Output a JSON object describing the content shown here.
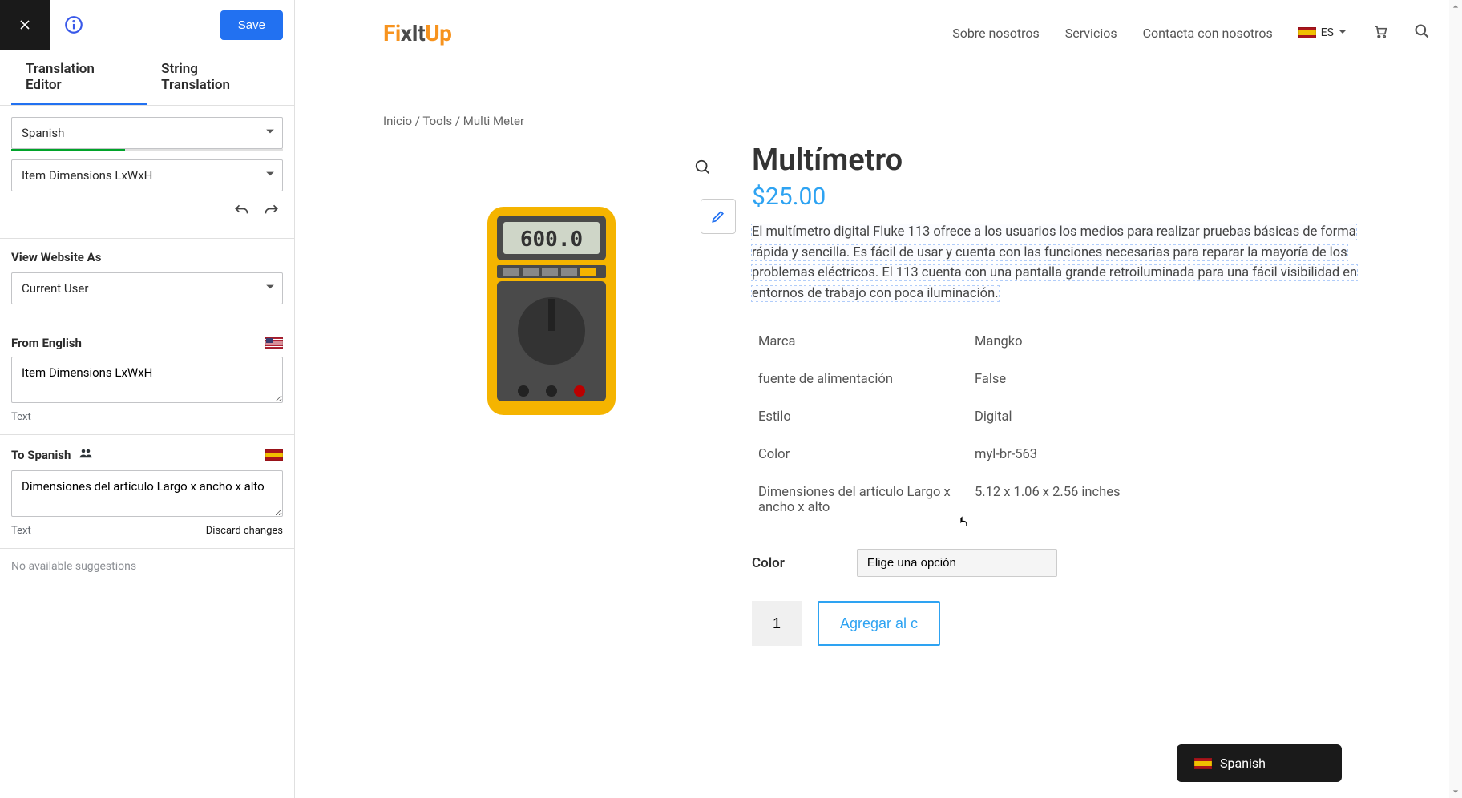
{
  "sidebar": {
    "save_label": "Save",
    "tabs": {
      "editor": "Translation Editor",
      "string": "String Translation"
    },
    "language_select": "Spanish",
    "item_select": "Item Dimensions LxWxH",
    "view_as_title": "View Website As",
    "view_as_value": "Current User",
    "from_label": "From English",
    "from_value": "Item Dimensions LxWxH",
    "from_type": "Text",
    "to_label": "To Spanish",
    "to_value": "Dimensiones del artículo Largo x ancho x alto",
    "to_type": "Text",
    "discard": "Discard changes",
    "no_suggestions": "No available suggestions"
  },
  "site": {
    "logo": {
      "a": "Fi",
      "b": "xIt",
      "c": "Up"
    },
    "nav": {
      "about": "Sobre nosotros",
      "services": "Servicios",
      "contact": "Contacta con nosotros",
      "lang": "ES"
    }
  },
  "breadcrumb": "Inicio / Tools / Multi Meter",
  "product": {
    "title": "Multímetro",
    "price": "$25.00",
    "description": "El multímetro digital Fluke 113 ofrece a los usuarios los medios para realizar pruebas básicas de forma rápida y sencilla. Es fácil de usar y cuenta con las funciones necesarias para reparar la mayoría de los problemas eléctricos. El 113 cuenta con una pantalla grande retroiluminada para una fácil visibilidad en entornos de trabajo con poca iluminación.",
    "attrs": [
      {
        "k": "Marca",
        "v": "Mangko"
      },
      {
        "k": "fuente de alimentación",
        "v": "False"
      },
      {
        "k": "Estilo",
        "v": "Digital"
      },
      {
        "k": "Color",
        "v": "myl-br-563"
      },
      {
        "k": "Dimensiones del artículo Largo x ancho x alto",
        "v": "5.12 x 1.06 x 2.56 inches"
      }
    ],
    "variation_label": "Color",
    "variation_placeholder": "Elige una opción",
    "qty": "1",
    "add_to_cart": "Agregar al c"
  },
  "lang_widget": "Spanish"
}
